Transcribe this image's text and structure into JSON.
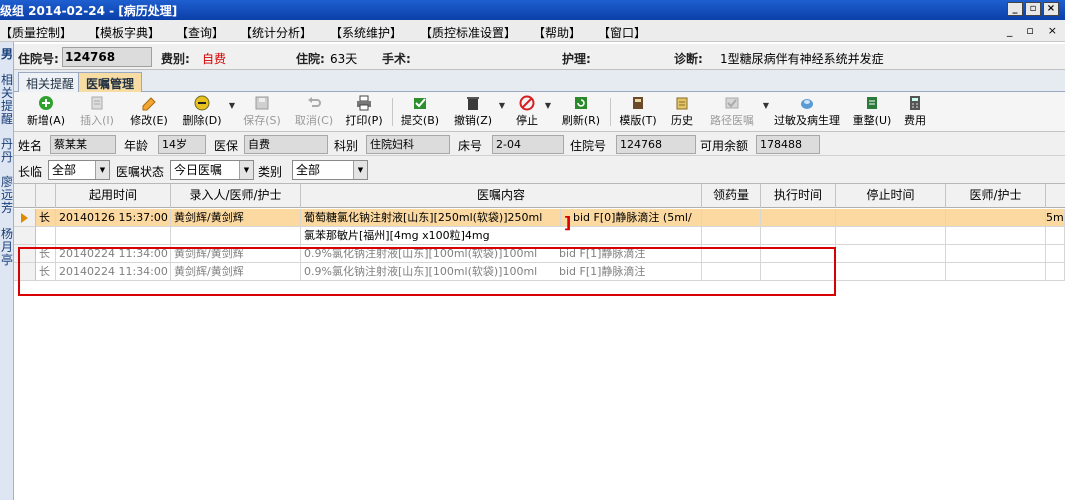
{
  "window": {
    "title": "级组  2014-02-24 - [病历处理]"
  },
  "menu": [
    "【质量控制】",
    "【模板字典】",
    "【查询】",
    "【统计分析】",
    "【系统维护】",
    "【质控标准设置】",
    "【帮助】",
    "【窗口】"
  ],
  "mdi_controls": [
    "_",
    "▫",
    "×"
  ],
  "left_strip": [
    "男",
    "相",
    "关",
    "提",
    "醒",
    "丹",
    "丹",
    "廖",
    "远",
    "芳",
    "杨",
    "月",
    "亭"
  ],
  "patient": {
    "inpatient_no_label": "住院号:",
    "inpatient_no": "124768",
    "fee_label": "费别:",
    "fee": "自费",
    "stay_label": "住院:",
    "stay": "63天",
    "surgery_label": "手术:",
    "nursing_label": "护理:",
    "diagnosis_label": "诊断:",
    "diagnosis": "1型糖尿病伴有神经系统并发症"
  },
  "tabs": [
    "相关提醒",
    "医嘱管理"
  ],
  "toolbar": [
    {
      "label": "新增(A)",
      "icon": "add-icon",
      "enabled": true
    },
    {
      "label": "插入(I)",
      "icon": "insert-icon",
      "enabled": false
    },
    {
      "label": "修改(E)",
      "icon": "edit-icon",
      "enabled": true
    },
    {
      "label": "删除(D)",
      "icon": "delete-icon",
      "enabled": true
    },
    {
      "label": "保存(S)",
      "icon": "save-icon",
      "enabled": false
    },
    {
      "label": "取消(C)",
      "icon": "undo-icon",
      "enabled": false
    },
    {
      "label": "打印(P)",
      "icon": "print-icon",
      "enabled": true
    },
    {
      "label": "提交(B)",
      "icon": "submit-icon",
      "enabled": true
    },
    {
      "label": "撤销(Z)",
      "icon": "revoke-icon",
      "enabled": true
    },
    {
      "label": "停止",
      "icon": "stop-icon",
      "enabled": true
    },
    {
      "label": "刷新(R)",
      "icon": "refresh-icon",
      "enabled": true
    },
    {
      "label": "模版(T)",
      "icon": "template-icon",
      "enabled": true
    },
    {
      "label": "历史",
      "icon": "history-icon",
      "enabled": true
    },
    {
      "label": "路径医嘱",
      "icon": "pathway-icon",
      "enabled": false
    },
    {
      "label": "过敏及病生理",
      "icon": "allergy-icon",
      "enabled": true
    },
    {
      "label": "重整(U)",
      "icon": "reorganize-icon",
      "enabled": true
    },
    {
      "label": "费用",
      "icon": "fee-icon",
      "enabled": true
    }
  ],
  "info": {
    "name_label": "姓名",
    "name": "蔡某某",
    "age_label": "年龄",
    "age": "14岁",
    "insurance_label": "医保",
    "insurance": "自费",
    "dept_label": "科别",
    "dept": "住院妇科",
    "bed_label": "床号",
    "bed": "2-04",
    "inpatient_label": "住院号",
    "inpatient": "124768",
    "balance_label": "可用余额",
    "balance": "178488"
  },
  "filter": {
    "longtemp_label": "长临",
    "longtemp": "全部",
    "status_label": "医嘱状态",
    "status": "今日医嘱",
    "category_label": "类别",
    "category": "全部"
  },
  "grid": {
    "columns": [
      "起用时间",
      "录入人/医师/护士",
      "医嘱内容",
      "领药量",
      "执行时间",
      "停止时间",
      "医师/护士"
    ],
    "rows": [
      {
        "type": "长",
        "time": "20140126 15:37:00",
        "entry": "黄剑辉/黄剑辉",
        "content": "葡萄糖氯化钠注射液[山东][250ml(软袋)]250ml",
        "freq": "bid F[0]静脉滴注 (5ml/",
        "overflow": "5ml"
      },
      {
        "type": "",
        "time": "",
        "entry": "",
        "content": "氯苯那敏片[福州][4mg x100粒]4mg",
        "freq": "",
        "overflow": ""
      },
      {
        "type": "长",
        "time": "20140224 11:34:00",
        "entry": "黄剑辉/黄剑辉",
        "content": "0.9%氯化钠注射液[山东][100ml(软袋)]100ml",
        "freq": "bid F[1]静脉滴注",
        "overflow": ""
      },
      {
        "type": "长",
        "time": "20140224 11:34:00",
        "entry": "黄剑辉/黄剑辉",
        "content": "0.9%氯化钠注射液[山东][100ml(软袋)]100ml",
        "freq": "bid F[1]静脉滴注",
        "overflow": ""
      }
    ]
  },
  "colors": {
    "title_blue": "#1f5fd0",
    "selected_row": "#fcd9a0",
    "highlight_red": "#d80000",
    "tab_active": "#f7dca4"
  }
}
